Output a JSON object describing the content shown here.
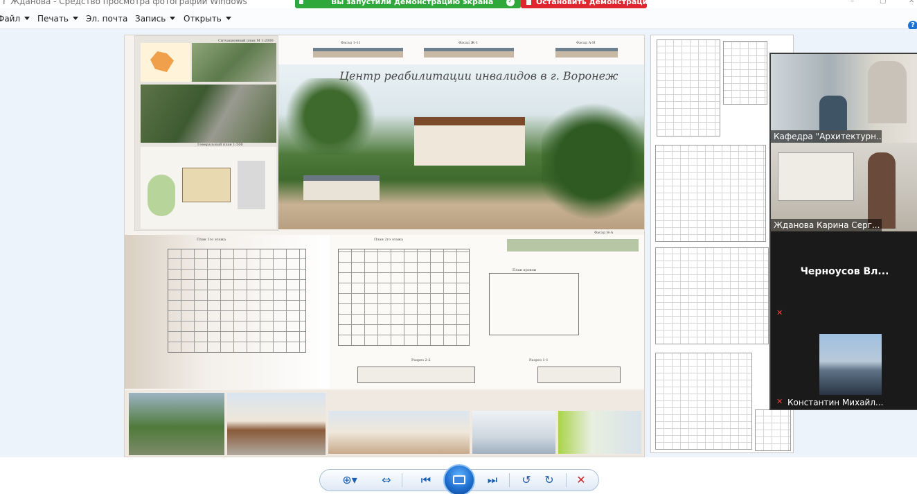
{
  "window": {
    "title": "Г Жданова - Средство просмотра фотографий Windows"
  },
  "share_banner": {
    "status_text": "Вы запустили демонстрацию экрана",
    "stop_label": "Остановить демонстрацию",
    "status_color": "#2fa83b",
    "stop_color": "#e0262e"
  },
  "menu": {
    "items": [
      {
        "label": "Файл",
        "has_dropdown": true
      },
      {
        "label": "Печать",
        "has_dropdown": true
      },
      {
        "label": "Эл. почта",
        "has_dropdown": false
      },
      {
        "label": "Запись",
        "has_dropdown": true
      },
      {
        "label": "Открыть",
        "has_dropdown": true
      }
    ],
    "help_icon": "help-icon"
  },
  "poster": {
    "title": "Центр реабилитации инвалидов в г. Воронеж",
    "labels": {
      "situation_plan": "Ситуационный план М 1:2000",
      "general_plan": "Генеральный план 1:500",
      "facade_1": "Фасад 1-11",
      "facade_2": "Фасад Ж-1",
      "facade_3": "Фасад А-Н",
      "facade_4": "Фасад Н-А",
      "plan_floor_1": "План 1го этажа",
      "plan_floor_2": "План 2го этажа",
      "plan_roof": "План кровли",
      "section_1": "Разрез 2-2",
      "section_2": "Разрез 1-1"
    }
  },
  "participants": [
    {
      "name": "Кафедра \"Архитектурн...",
      "video": true,
      "muted": false
    },
    {
      "name": "Жданова Карина Серг...",
      "video": true,
      "muted": false
    },
    {
      "name": "Черноусов  Вл...",
      "video": false,
      "muted": true
    },
    {
      "name": "Константин Михайл...",
      "video": false,
      "muted": true
    }
  ],
  "toolbar": {
    "buttons": [
      {
        "icon": "zoom-icon"
      },
      {
        "icon": "actual-size-icon"
      },
      {
        "icon": "previous-icon"
      },
      {
        "icon": "slideshow-icon"
      },
      {
        "icon": "next-icon"
      },
      {
        "icon": "rotate-left-icon"
      },
      {
        "icon": "rotate-right-icon"
      },
      {
        "icon": "delete-icon"
      }
    ],
    "accent_color": "#1b5fb0",
    "delete_color": "#c8232b"
  }
}
